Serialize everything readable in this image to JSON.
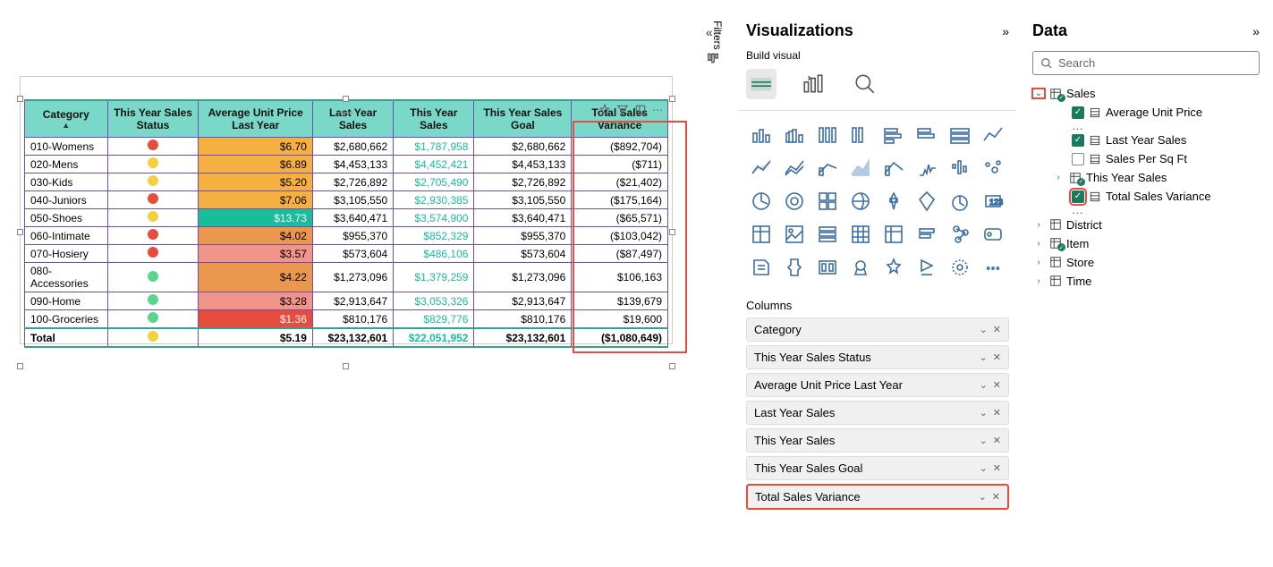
{
  "canvas": {
    "icon_pin": "📌",
    "icon_filter": "⚟",
    "icon_focus": "⛶",
    "icon_more": "⋯"
  },
  "table": {
    "headers": [
      "Category",
      "This Year Sales Status",
      "Average Unit Price Last Year",
      "Last Year Sales",
      "This Year Sales",
      "This Year Sales Goal",
      "Total Sales Variance"
    ],
    "rows": [
      {
        "cat": "010-Womens",
        "status": "red",
        "price": "$6.70",
        "last": "$2,680,662",
        "this": "$1,787,958",
        "goal": "$2,680,662",
        "var": "($892,704)"
      },
      {
        "cat": "020-Mens",
        "status": "yellow",
        "price": "$6.89",
        "last": "$4,453,133",
        "this": "$4,452,421",
        "goal": "$4,453,133",
        "var": "($711)"
      },
      {
        "cat": "030-Kids",
        "status": "yellow",
        "price": "$5.20",
        "last": "$2,726,892",
        "this": "$2,705,490",
        "goal": "$2,726,892",
        "var": "($21,402)"
      },
      {
        "cat": "040-Juniors",
        "status": "red",
        "price": "$7.06",
        "last": "$3,105,550",
        "this": "$2,930,385",
        "goal": "$3,105,550",
        "var": "($175,164)"
      },
      {
        "cat": "050-Shoes",
        "status": "yellow",
        "price": "$13.73",
        "last": "$3,640,471",
        "this": "$3,574,900",
        "goal": "$3,640,471",
        "var": "($65,571)"
      },
      {
        "cat": "060-Intimate",
        "status": "red",
        "price": "$4.02",
        "last": "$955,370",
        "this": "$852,329",
        "goal": "$955,370",
        "var": "($103,042)"
      },
      {
        "cat": "070-Hosiery",
        "status": "red",
        "price": "$3.57",
        "last": "$573,604",
        "this": "$486,106",
        "goal": "$573,604",
        "var": "($87,497)"
      },
      {
        "cat": "080-Accessories",
        "status": "green",
        "price": "$4.22",
        "last": "$1,273,096",
        "this": "$1,379,259",
        "goal": "$1,273,096",
        "var": "$106,163"
      },
      {
        "cat": "090-Home",
        "status": "green",
        "price": "$3.28",
        "last": "$2,913,647",
        "this": "$3,053,326",
        "goal": "$2,913,647",
        "var": "$139,679"
      },
      {
        "cat": "100-Groceries",
        "status": "green",
        "price": "$1.36",
        "last": "$810,176",
        "this": "$829,776",
        "goal": "$810,176",
        "var": "$19,600"
      }
    ],
    "total": {
      "label": "Total",
      "status": "yellow",
      "price": "$5.19",
      "last": "$23,132,601",
      "this": "$22,051,952",
      "goal": "$23,132,601",
      "var": "($1,080,649)"
    }
  },
  "filters": {
    "label": "Filters"
  },
  "viz": {
    "title": "Visualizations",
    "build_label": "Build visual",
    "columns_label": "Columns",
    "columns": [
      "Category",
      "This Year Sales Status",
      "Average Unit Price Last Year",
      "Last Year Sales",
      "This Year Sales",
      "This Year Sales Goal",
      "Total Sales Variance"
    ]
  },
  "data": {
    "title": "Data",
    "search_placeholder": "Search",
    "tree": {
      "sales": "Sales",
      "avg_unit_price": "Average Unit Price",
      "last_year_sales": "Last Year Sales",
      "sales_per_sqft": "Sales Per Sq Ft",
      "this_year_sales": "This Year Sales",
      "total_sales_variance": "Total Sales Variance",
      "district": "District",
      "item": "Item",
      "store": "Store",
      "time": "Time"
    }
  }
}
